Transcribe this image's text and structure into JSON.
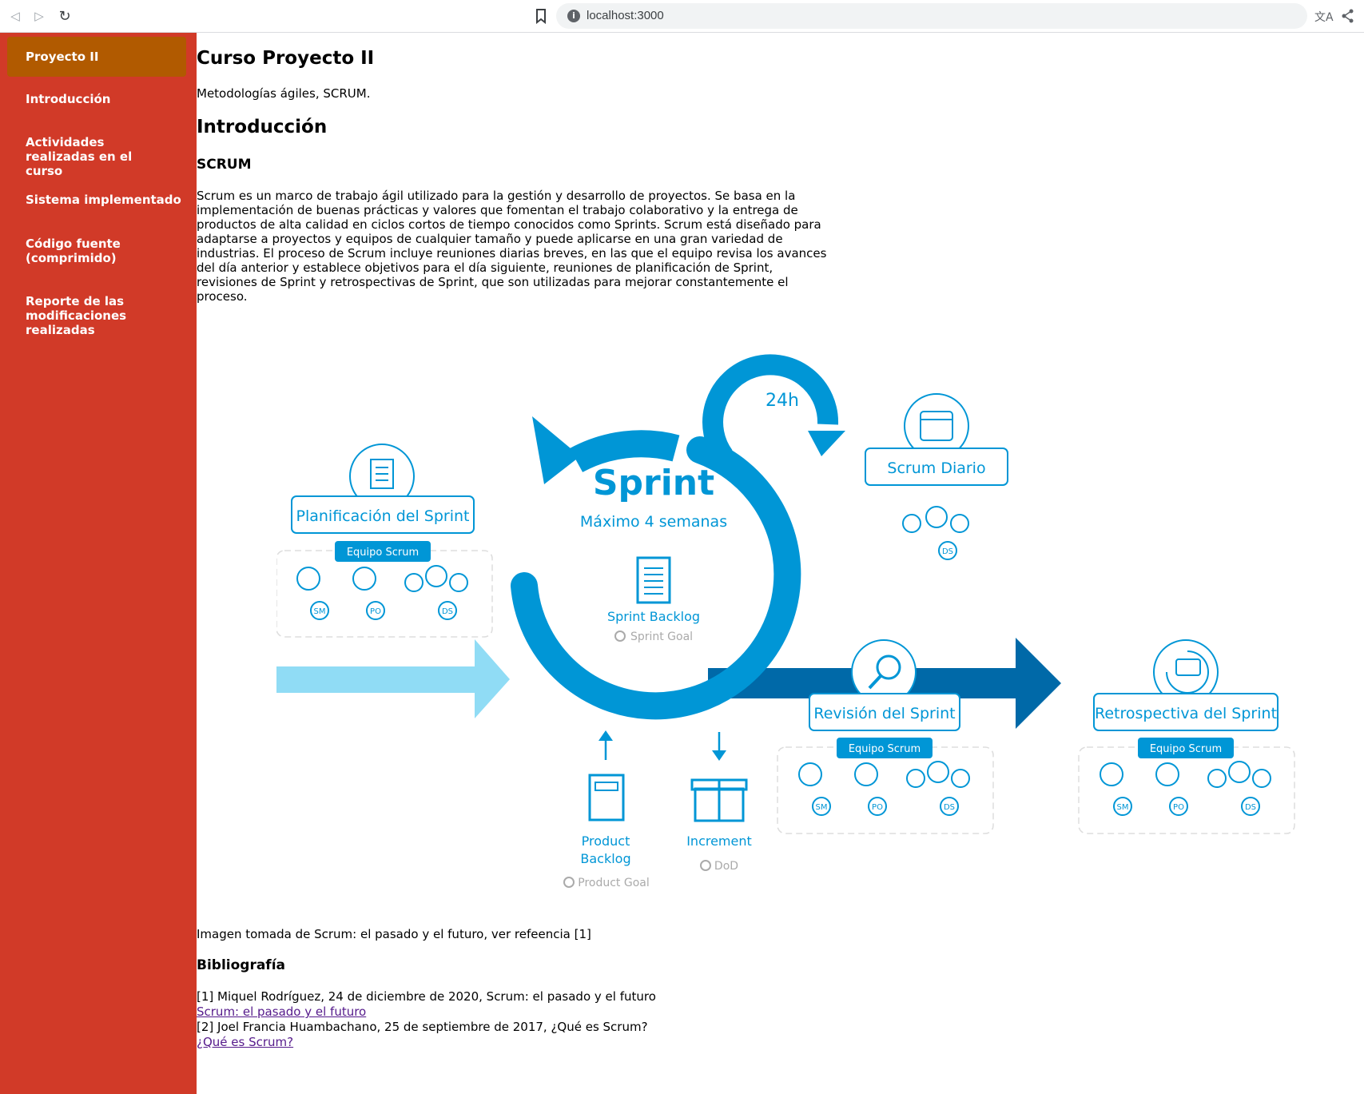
{
  "browser": {
    "url": "localhost:3000"
  },
  "sidebar": {
    "items": [
      {
        "label": "Proyecto II",
        "active": true
      },
      {
        "label": "Introducción"
      },
      {
        "label": "Actividades realizadas en el curso"
      },
      {
        "label": "Sistema implementado"
      },
      {
        "label": "Código fuente (comprimido)"
      },
      {
        "label": "Reporte de las modificaciones realizadas"
      }
    ]
  },
  "main": {
    "title": "Curso Proyecto II",
    "subtitle": "Metodologías ágiles, SCRUM.",
    "section_title": "Introducción",
    "subsection_title": "SCRUM",
    "paragraph": "Scrum es un marco de trabajo ágil utilizado para la gestión y desarrollo de proyectos. Se basa en la implementación de buenas prácticas y valores que fomentan el trabajo colaborativo y la entrega de productos de alta calidad en ciclos cortos de tiempo conocidos como Sprints. Scrum está diseñado para adaptarse a proyectos y equipos de cualquier tamaño y puede aplicarse en una gran variedad de industrias. El proceso de Scrum incluye reuniones diarias breves, en las que el equipo revisa los avances del día anterior y establece objetivos para el día siguiente, reuniones de planificación de Sprint, revisiones de Sprint y retrospectivas de Sprint, que son utilizadas para mejorar constantemente el proceso.",
    "caption": "Imagen tomada de Scrum: el pasado y el futuro, ver refeencia [1]",
    "bibliography_title": "Bibliografía",
    "references": [
      {
        "text": "[1] Miquel Rodríguez, 24 de diciembre de 2020, Scrum: el pasado y el futuro",
        "link": "Scrum: el pasado y el futuro"
      },
      {
        "text": "[2] Joel Francia Huambachano, 25 de septiembre de 2017, ¿Qué es Scrum?",
        "link": "¿Qué es Scrum?"
      }
    ]
  },
  "diagram": {
    "sprint_title": "Sprint",
    "sprint_duration": "Máximo 4 semanas",
    "daily_cycle": "24h",
    "sprint_backlog": "Sprint Backlog",
    "sprint_goal": "Sprint Goal",
    "planning": "Planificación del Sprint",
    "daily": "Scrum Diario",
    "review": "Revisión del Sprint",
    "retrospective": "Retrospectiva del Sprint",
    "team_label": "Equipo Scrum",
    "product_backlog_line1": "Product",
    "product_backlog_line2": "Backlog",
    "product_goal": "Product Goal",
    "increment": "Increment",
    "dod": "DoD",
    "role_sm": "SM",
    "role_po": "PO",
    "role_ds": "DS",
    "colors": {
      "primary": "#0096d6",
      "dark": "#0069a8",
      "light": "#90dcf5"
    }
  }
}
